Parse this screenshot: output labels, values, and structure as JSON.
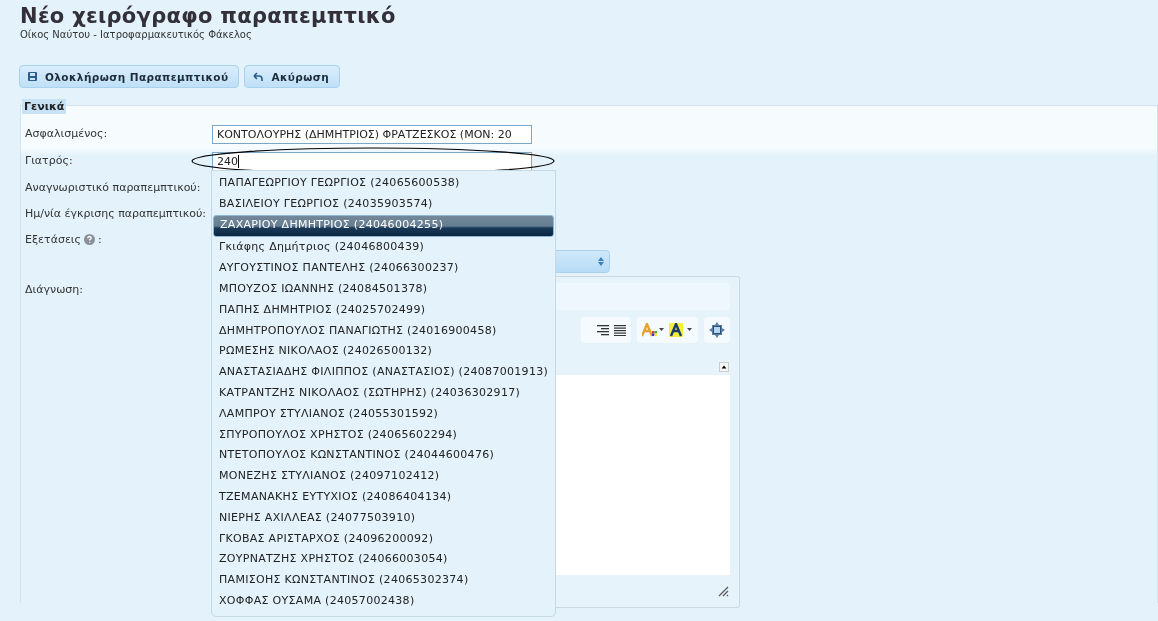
{
  "page": {
    "title": "Νέο χειρόγραφο παραπεμπτικό",
    "subtitle": "Οίκος Ναύτου - Ιατροφαρμακευτικός Φάκελος"
  },
  "toolbar": [
    {
      "label": "Ολοκλήρωση Παραπεμπτικού"
    },
    {
      "label": "Ακύρωση"
    }
  ],
  "section": {
    "legend": "Γενικά",
    "fields": [
      {
        "label": "Ασφαλισμένος:",
        "kind": "text",
        "value": "ΚΟΝΤΟΛΟΥΡΗΣ (ΔΗΜΗΤΡΙΟΣ) ΦΡΑΤΖΕΣΚΟΣ (ΜΟΝ: 20",
        "circled": false
      },
      {
        "label": "Γιατρός:",
        "kind": "text",
        "value": "240",
        "circled": true
      },
      {
        "label": "Αναγνωριστικό παραπεμπτικού:",
        "kind": "covered"
      },
      {
        "label": "Ημ/νία έγκρισης παραπεμπτικού:",
        "kind": "covered"
      },
      {
        "label": "Εξετάσεις",
        "help": true,
        "suffix": ":",
        "kind": "select"
      },
      {
        "label": "Διάγνωση:",
        "kind": "editor"
      }
    ]
  },
  "autocomplete": {
    "items": [
      {
        "text": "ΠΑΠΑΓΕΩΡΓΙΟΥ ΓΕΩΡΓΙΟΣ (24065600538)",
        "selected": false
      },
      {
        "text": "ΒΑΣΙΛΕΙΟΥ ΓΕΩΡΓΙΟΣ (24035903574)",
        "selected": false
      },
      {
        "text": "ΖΑΧΑΡΙΟΥ ΔΗΜΗΤΡΙΟΣ (24046004255)",
        "selected": true
      },
      {
        "text": "Γκιάφης Δημήτριος (24046800439)",
        "selected": false
      },
      {
        "text": "ΑΥΓΟΥΣΤΙΝΟΣ ΠΑΝΤΕΛΗΣ (24066300237)",
        "selected": false
      },
      {
        "text": "ΜΠΟΥΖΟΣ ΙΩΑΝΝΗΣ (24084501378)",
        "selected": false
      },
      {
        "text": "ΠΑΠΗΣ ΔΗΜΗΤΡΙΟΣ (24025702499)",
        "selected": false
      },
      {
        "text": "ΔΗΜΗΤΡΟΠΟΥΛΟΣ ΠΑΝΑΓΙΩΤΗΣ (24016900458)",
        "selected": false
      },
      {
        "text": "ΡΩΜΕΣΗΣ ΝΙΚΟΛΑΟΣ (24026500132)",
        "selected": false
      },
      {
        "text": "ΑΝΑΣΤΑΣΙΑΔΗΣ ΦΙΛΙΠΠΟΣ (ΑΝΑΣΤΑΣΙΟΣ) (24087001913)",
        "selected": false
      },
      {
        "text": "ΚΑΤΡΑΝΤΖΗΣ ΝΙΚΟΛΑΟΣ (ΣΩΤΗΡΗΣ) (24036302917)",
        "selected": false
      },
      {
        "text": "ΛΑΜΠΡΟΥ ΣΤΥΛΙΑΝΟΣ (24055301592)",
        "selected": false
      },
      {
        "text": "ΣΠΥΡΟΠΟΥΛΟΣ ΧΡΗΣΤΟΣ (24065602294)",
        "selected": false
      },
      {
        "text": "ΝΤΕΤΟΠΟΥΛΟΣ ΚΩΝΣΤΑΝΤΙΝΟΣ (24044600476)",
        "selected": false
      },
      {
        "text": "ΜΟΝΕΖΗΣ ΣΤΥΛΙΑΝΟΣ (24097102412)",
        "selected": false
      },
      {
        "text": "ΤΖΕΜΑΝΑΚΗΣ ΕΥΤΥΧΙΟΣ (24086404134)",
        "selected": false
      },
      {
        "text": "ΝΙΕΡΗΣ ΑΧΙΛΛΕΑΣ (24077503910)",
        "selected": false
      },
      {
        "text": "ΓΚΟΒΑΣ ΑΡΙΣΤΑΡΧΟΣ (24096200092)",
        "selected": false
      },
      {
        "text": "ΖΟΥΡΝΑΤΖΗΣ ΧΡΗΣΤΟΣ (24066003054)",
        "selected": false
      },
      {
        "text": "ΠΑΜΙΣΟΗΣ ΚΩΝΣΤΑΝΤΙΝΟΣ (24065302374)",
        "selected": false
      },
      {
        "text": "ΧΟΦΦΑΣ ΟΥΣΑΜΑ (24057002438)",
        "selected": false
      }
    ]
  }
}
